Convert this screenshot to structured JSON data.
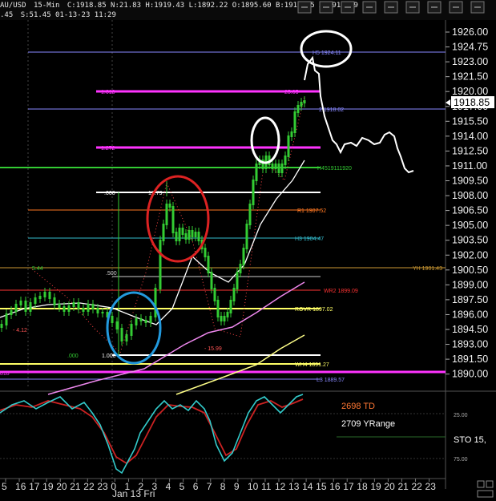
{
  "title_bar": {
    "left_fragment": ".45",
    "symbol": "AU/USD",
    "interval": "15-Min",
    "ohlc_text": "C:1918.85  N:21.83  H:1919.43  L:1892.22  O:1895.60  B:1918.85  A:1919.19  V:7",
    "time_text": "S:51.45  01-13-23  11:29",
    "icons": [
      "save-icon",
      "zoom-in-icon",
      "zoom-out-icon",
      "crosshair-icon",
      "grid-icon",
      "draw-icon",
      "settings-icon",
      "scroll-left-icon",
      "scroll-right-icon"
    ]
  },
  "price_axis": {
    "ticks": [
      "1926.00",
      "1924.75",
      "1923.00",
      "1921.50",
      "1920.00",
      "1917.00",
      "1915.50",
      "1914.00",
      "1912.50",
      "1911.00",
      "1909.50",
      "1908.00",
      "1906.50",
      "1905.00",
      "1903.50",
      "1902.00",
      "1900.50",
      "1899.00",
      "1897.50",
      "1896.00",
      "1894.50",
      "1893.00",
      "1891.50",
      "1890.00"
    ],
    "current_price": "1918.85"
  },
  "time_axis": {
    "ticks": [
      "5",
      "16",
      "17",
      "19",
      "20",
      "21",
      "22",
      "23",
      "0",
      "1",
      "2",
      "3",
      "4",
      "5",
      "6",
      "7",
      "8",
      "9",
      "10",
      "11",
      "12",
      "13",
      "14",
      "15",
      "16",
      "17",
      "18",
      "19",
      "20",
      "21",
      "22",
      "23"
    ],
    "date_label": "Jan 13 Fri"
  },
  "levels": [
    {
      "id": "h5",
      "label": "H5 1924.11",
      "color": "#8888ff"
    },
    {
      "id": "fib1618",
      "label": "1.618",
      "right_label": "25.05",
      "color": "#ff33ff"
    },
    {
      "id": "h4",
      "label": "2 1918.02",
      "color": "#8888ff"
    },
    {
      "id": "fib1272",
      "label": "1.272",
      "color": "#ff33ff"
    },
    {
      "id": "h4519",
      "label": "H4519111920",
      "color": "#33cc33"
    },
    {
      "id": "zero",
      "label": ".000",
      "right_label": "17.79",
      "color": "#ffffff"
    },
    {
      "id": "r1",
      "label": "R1 1907.52",
      "color": "#ff7722"
    },
    {
      "id": "h3",
      "label": "H3 1904.47",
      "color": "#33bbcc"
    },
    {
      "id": "yh",
      "label": "YH 1901.43",
      "color": "#cc9933"
    },
    {
      "id": "fifty",
      "label": ".500",
      "color": "#cccccc"
    },
    {
      "id": "five44",
      "label": "5.44",
      "color": "#33cc33"
    },
    {
      "id": "wr2",
      "label": "WR2 1899.09",
      "color": "#ff3333"
    },
    {
      "id": "rovr",
      "label": "ROVR 1897.02",
      "color": "#ffff66"
    },
    {
      "id": "m412",
      "label": "- 4.12",
      "color": "#ff5555"
    },
    {
      "id": "m1599",
      "label": "- 15.99",
      "color": "#ff5555"
    },
    {
      "id": "one000",
      "label": "1.000",
      "color": "#ffffff"
    },
    {
      "id": "zero2",
      "label": ".000",
      "color": "#33cc33"
    },
    {
      "id": "wh4",
      "label": "WH4 1891.27",
      "color": "#ffff66"
    },
    {
      "id": "ppp",
      "label": "818",
      "color": "#ff33ff"
    },
    {
      "id": "l3",
      "label": "L3 1889.57",
      "color": "#8888ff"
    }
  ],
  "oscillator": {
    "td_text": "2698 TD",
    "range_text": "2709 YRange",
    "sto_text": "STO  15,",
    "lvl_upper": "25.00",
    "lvl_lower": "75.00"
  },
  "colors": {
    "green_candle": "#33cc33",
    "white_ma": "#ffffff",
    "pink_ma": "#ee88ee",
    "yellow_ma": "#ffff88",
    "blue_circle": "#2299dd",
    "red_circle": "#dd2222",
    "sto_fast": "#33cccc",
    "sto_slow": "#cc2222"
  }
}
